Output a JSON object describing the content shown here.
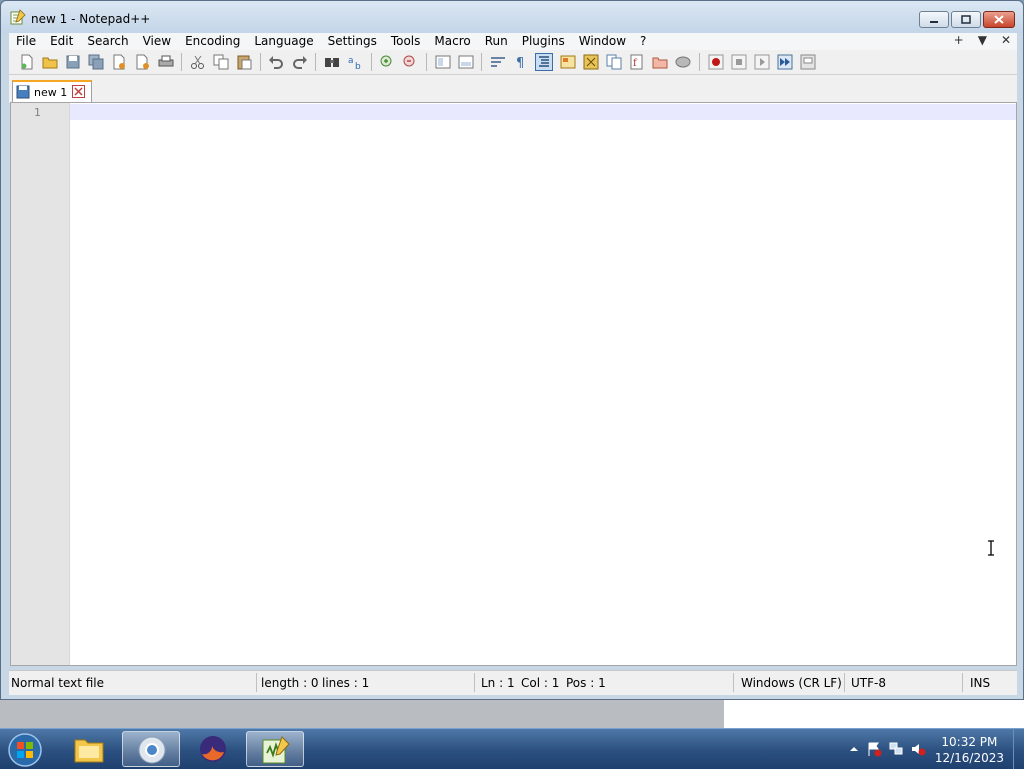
{
  "window": {
    "title": "new 1 - Notepad++"
  },
  "menu": {
    "items": [
      "File",
      "Edit",
      "Search",
      "View",
      "Encoding",
      "Language",
      "Settings",
      "Tools",
      "Macro",
      "Run",
      "Plugins",
      "Window",
      "?"
    ],
    "right": [
      "+",
      "▼",
      "✕"
    ]
  },
  "tab": {
    "label": "new 1"
  },
  "editor": {
    "line_number": "1"
  },
  "status": {
    "file_type": "Normal text file",
    "length": "length : 0",
    "lines": "lines : 1",
    "ln": "Ln : 1",
    "col": "Col : 1",
    "pos": "Pos : 1",
    "eol": "Windows (CR LF)",
    "encoding": "UTF-8",
    "mode": "INS"
  },
  "taskbar": {
    "apps": [
      "file-explorer-icon",
      "chrome-icon",
      "firefox-icon",
      "notepadpp-icon"
    ],
    "clock_time": "10:32 PM",
    "clock_date": "12/16/2023"
  },
  "colors": {
    "tab_accent": "#f5a623",
    "current_line": "#e8e8ff",
    "gutter": "#e4e4e4"
  }
}
